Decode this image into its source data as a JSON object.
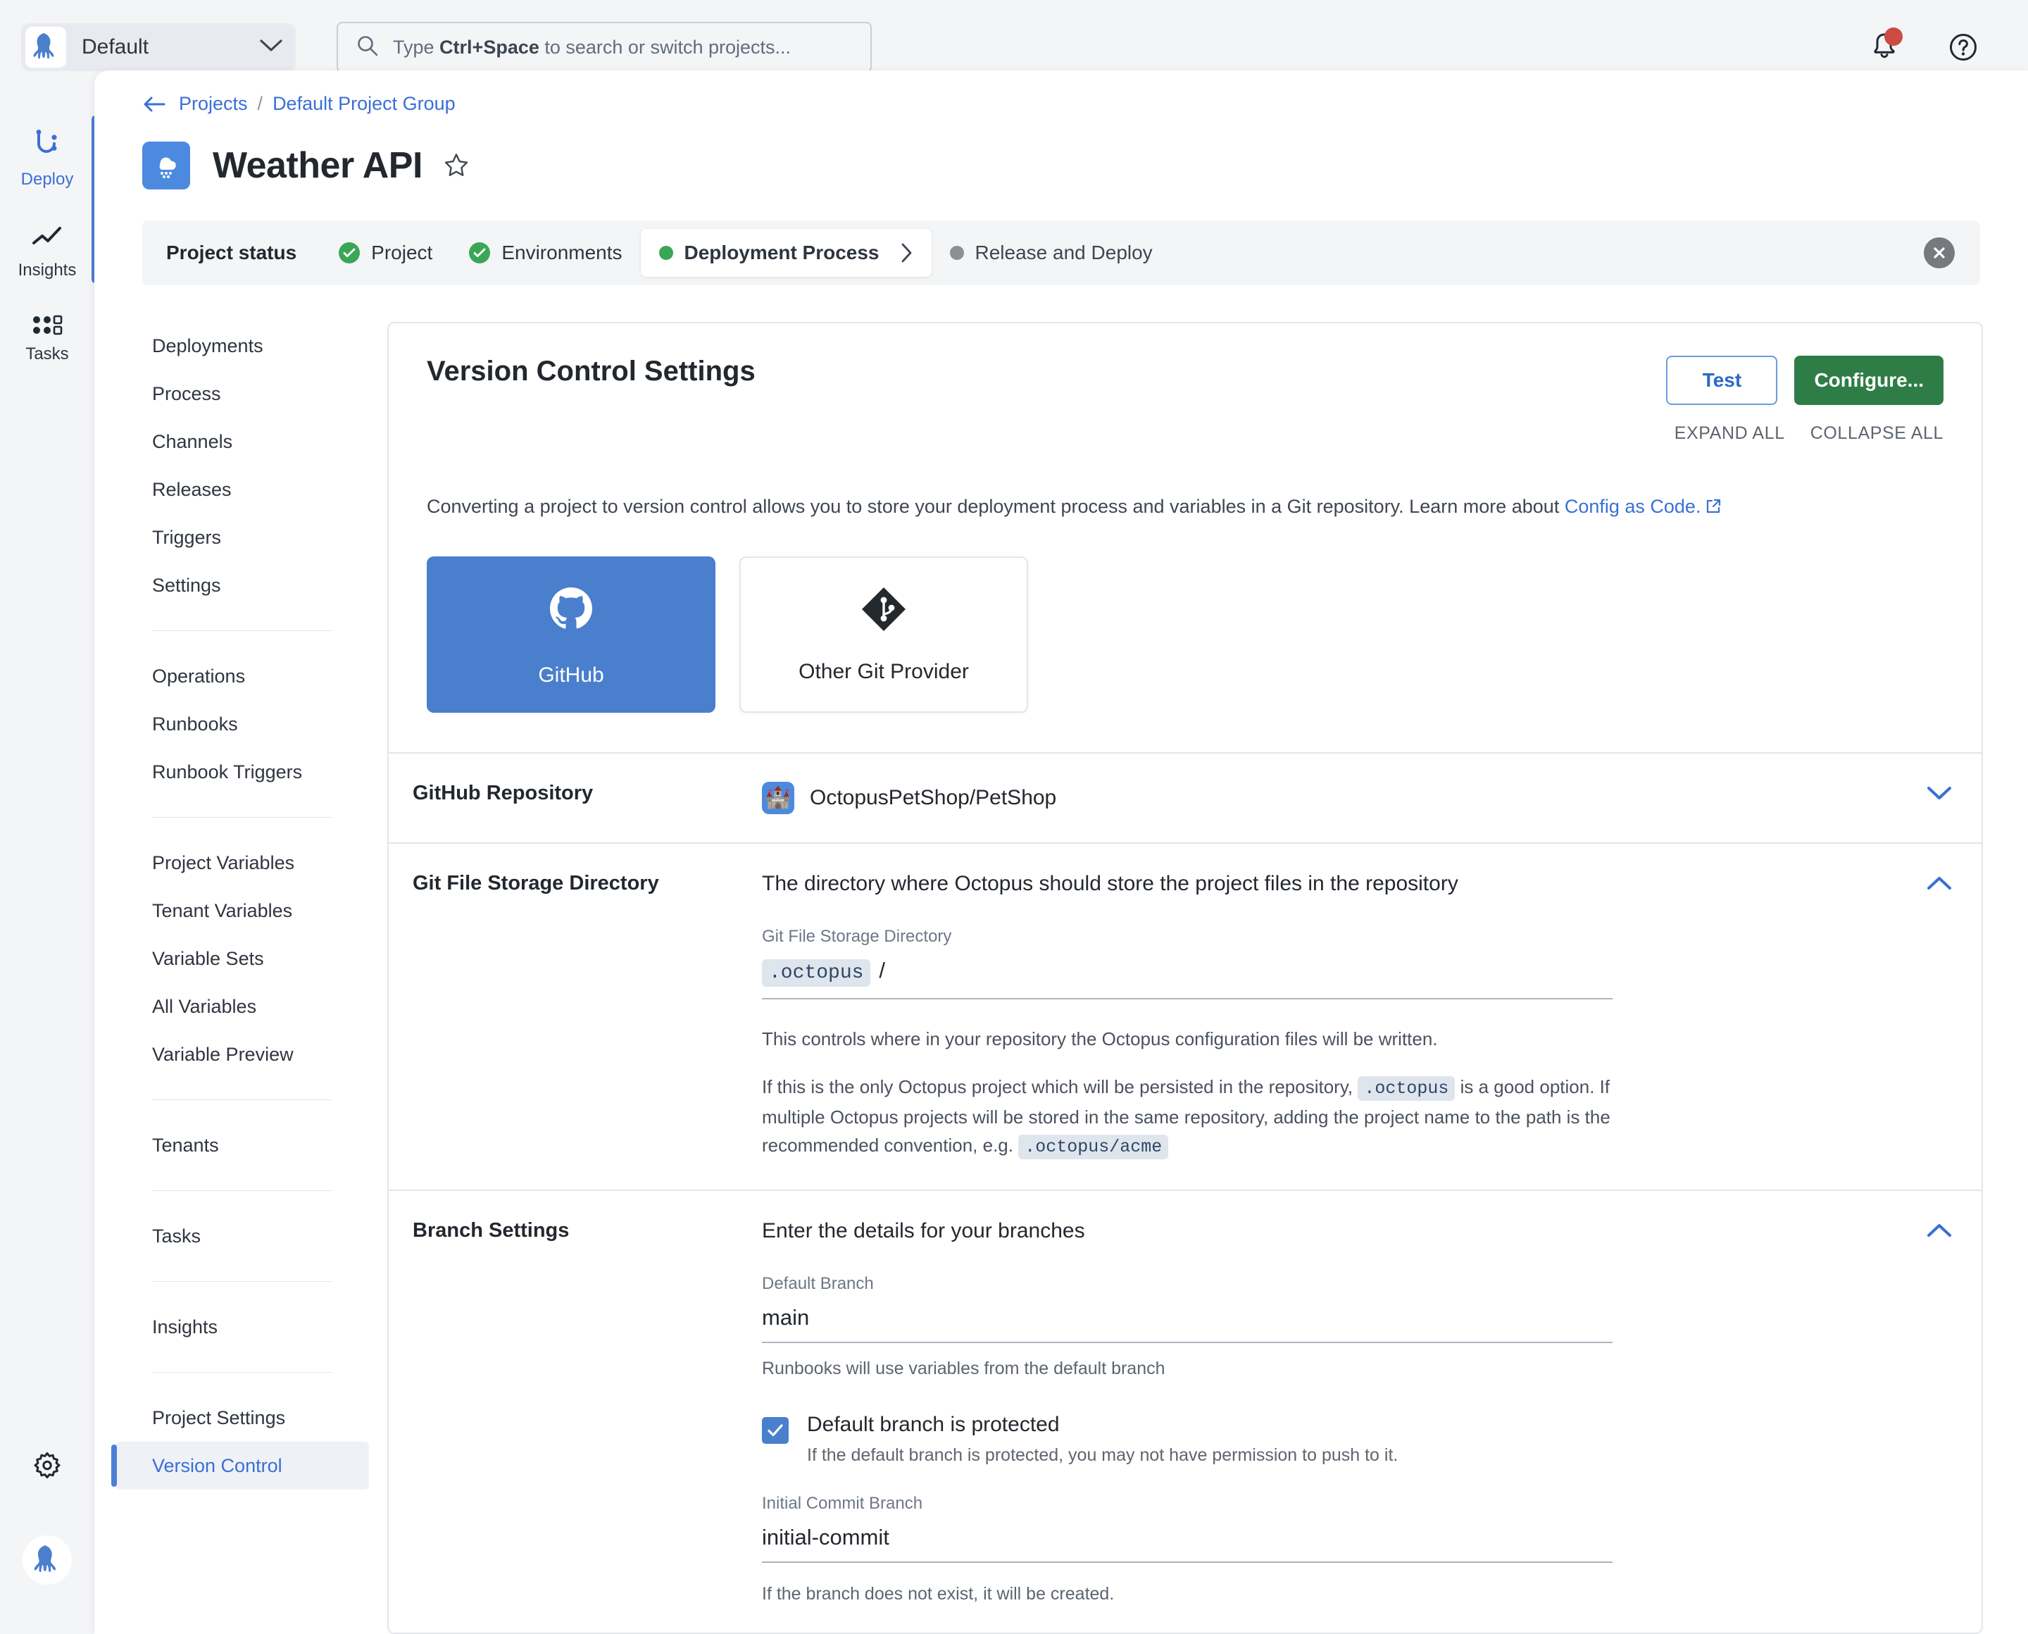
{
  "topbar": {
    "space_name": "Default",
    "space_icon": "octopus-logo-icon",
    "search_placeholder_prefix": "Type ",
    "search_placeholder_key": "Ctrl+Space",
    "search_placeholder_suffix": " to search or switch projects...",
    "search_value": "",
    "notifications_icon": "bell-icon",
    "has_unread_notifications": true,
    "help_icon": "help-circle-icon"
  },
  "rail": {
    "items": [
      {
        "label": "Deploy",
        "icon": "deploy-icon",
        "active": true
      },
      {
        "label": "Insights",
        "icon": "insights-line-chart-icon",
        "active": false
      },
      {
        "label": "Tasks",
        "icon": "tasks-grid-icon",
        "active": false
      }
    ],
    "settings_icon": "gear-icon",
    "avatar_icon": "octopus-avatar-icon"
  },
  "breadcrumb": {
    "back_icon": "arrow-left-icon",
    "projects": "Projects",
    "separator": "/",
    "group": "Default Project Group"
  },
  "page": {
    "project_icon": "rain-cloud-icon",
    "title": "Weather API",
    "favorite_icon": "star-outline-icon"
  },
  "status_bar": {
    "label": "Project status",
    "steps": [
      {
        "label": "Project",
        "state": "done"
      },
      {
        "label": "Environments",
        "state": "done"
      },
      {
        "label": "Deployment Process",
        "state": "current"
      },
      {
        "label": "Release and Deploy",
        "state": "pending"
      }
    ],
    "current_chevron_icon": "chevron-right-icon",
    "close_icon": "close-icon"
  },
  "subnav": {
    "groups": [
      {
        "items": [
          {
            "label": "Deployments",
            "active": false
          },
          {
            "label": "Process",
            "active": false
          },
          {
            "label": "Channels",
            "active": false
          },
          {
            "label": "Releases",
            "active": false
          },
          {
            "label": "Triggers",
            "active": false
          },
          {
            "label": "Settings",
            "active": false
          }
        ]
      },
      {
        "items": [
          {
            "label": "Operations",
            "active": false
          },
          {
            "label": "Runbooks",
            "active": false
          },
          {
            "label": "Runbook Triggers",
            "active": false
          }
        ]
      },
      {
        "items": [
          {
            "label": "Project Variables",
            "active": false
          },
          {
            "label": "Tenant Variables",
            "active": false
          },
          {
            "label": "Variable Sets",
            "active": false
          },
          {
            "label": "All Variables",
            "active": false
          },
          {
            "label": "Variable Preview",
            "active": false
          }
        ]
      },
      {
        "items": [
          {
            "label": "Tenants",
            "active": false
          }
        ]
      },
      {
        "items": [
          {
            "label": "Tasks",
            "active": false
          }
        ]
      },
      {
        "items": [
          {
            "label": "Insights",
            "active": false
          }
        ]
      },
      {
        "items": [
          {
            "label": "Project Settings",
            "active": false
          },
          {
            "label": "Version Control",
            "active": true
          }
        ]
      }
    ]
  },
  "card": {
    "title": "Version Control Settings",
    "test_button": "Test",
    "configure_button": "Configure...",
    "expand_all": "EXPAND ALL",
    "collapse_all": "COLLAPSE ALL",
    "intro_text": "Converting a project to version control allows you to store your deployment process and variables in a Git repository. Learn more about ",
    "intro_link": "Config as Code.",
    "external_link_icon": "external-link-icon",
    "providers": [
      {
        "name": "GitHub",
        "icon": "github-icon",
        "selected": true
      },
      {
        "name": "Other Git Provider",
        "icon": "git-icon",
        "selected": false
      }
    ],
    "sections": [
      {
        "label": "GitHub Repository",
        "value": "OctopusPetShop/PetShop",
        "repo_icon": "castle-icon",
        "expanded": false,
        "chevron_icon": "chevron-down-icon"
      },
      {
        "label": "Git File Storage Directory",
        "headline": "The directory where Octopus should store the project files in the repository",
        "expanded": true,
        "chevron_icon": "chevron-up-icon",
        "field_label": "Git File Storage Directory",
        "field_value": ".octopus",
        "field_suffix": "/",
        "help_1": "This controls where in your repository the Octopus configuration files will be written.",
        "help_2_a": "If this is the only Octopus project which will be persisted in the repository, ",
        "help_2_code1": ".octopus",
        "help_2_b": " is a good option. If multiple Octopus projects will be stored in the same repository, adding the project name to the path is the recommended convention, e.g. ",
        "help_2_code2": ".octopus/acme"
      },
      {
        "label": "Branch Settings",
        "headline": "Enter the details for your branches",
        "expanded": true,
        "chevron_icon": "chevron-up-icon",
        "default_branch_label": "Default Branch",
        "default_branch_value": "main",
        "default_branch_help": "Runbooks will use variables from the default branch",
        "protected_checkbox_label": "Default branch is protected",
        "protected_checkbox_checked": true,
        "protected_checkbox_help": "If the default branch is protected, you may not have permission to push to it.",
        "initial_commit_label": "Initial Commit Branch",
        "initial_commit_value": "initial-commit",
        "initial_commit_help": "If the branch does not exist, it will be created."
      }
    ]
  },
  "colors": {
    "accent_blue": "#3b6fd4",
    "provider_selected": "#4a7fce",
    "configure_green": "#2f7d46",
    "status_done_green": "#3aa757",
    "notification_red": "#cc4b42",
    "panel_bg": "#ffffff",
    "app_bg": "#f4f5f7"
  }
}
